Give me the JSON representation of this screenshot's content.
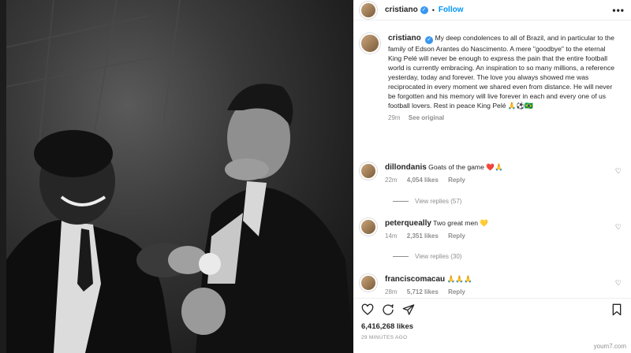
{
  "post": {
    "username": "cristiano",
    "follow_label": "Follow",
    "more_label": "•••",
    "verified_glyph": "✓",
    "separator": "•"
  },
  "caption": {
    "username": "cristiano",
    "text": "My deep condolences to all of Brazil, and in particular to the family of Edson Arantes do Nascimento. A mere \"goodbye\" to the eternal King Pelé will never be enough to express the pain that the entire football world is currently embracing. An inspiration to so many millions, a reference yesterday, today and forever. The love you always showed me was reciprocated in every moment we shared even from distance. He will never be forgotten and his memory will live forever in each and every one of us football lovers. Rest in peace King Pelé 🙏⚽🇧🇷",
    "time": "29m",
    "see_original": "See original"
  },
  "comments": [
    {
      "username": "dillondanis",
      "text": "Goats of the game ❤️🙏",
      "time": "22m",
      "likes": "4,054 likes",
      "reply": "Reply",
      "view_replies": "View replies (57)"
    },
    {
      "username": "peterqueally",
      "text": "Two great men 💛",
      "time": "14m",
      "likes": "2,351 likes",
      "reply": "Reply",
      "view_replies": "View replies (30)"
    },
    {
      "username": "franciscomacau",
      "text": "🙏🙏🙏",
      "time": "28m",
      "likes": "5,712 likes",
      "reply": "Reply"
    }
  ],
  "actions": {
    "likes": "6,416,268 likes",
    "timestamp": "29 MINUTES AGO"
  },
  "watermark": "youm7.com",
  "colors": {
    "accent": "#0095f6",
    "verified": "#3897f0",
    "muted": "#8e8e8e"
  },
  "icons": [
    "heart-icon",
    "comment-icon",
    "share-icon",
    "bookmark-icon",
    "verified-icon",
    "more-icon"
  ]
}
